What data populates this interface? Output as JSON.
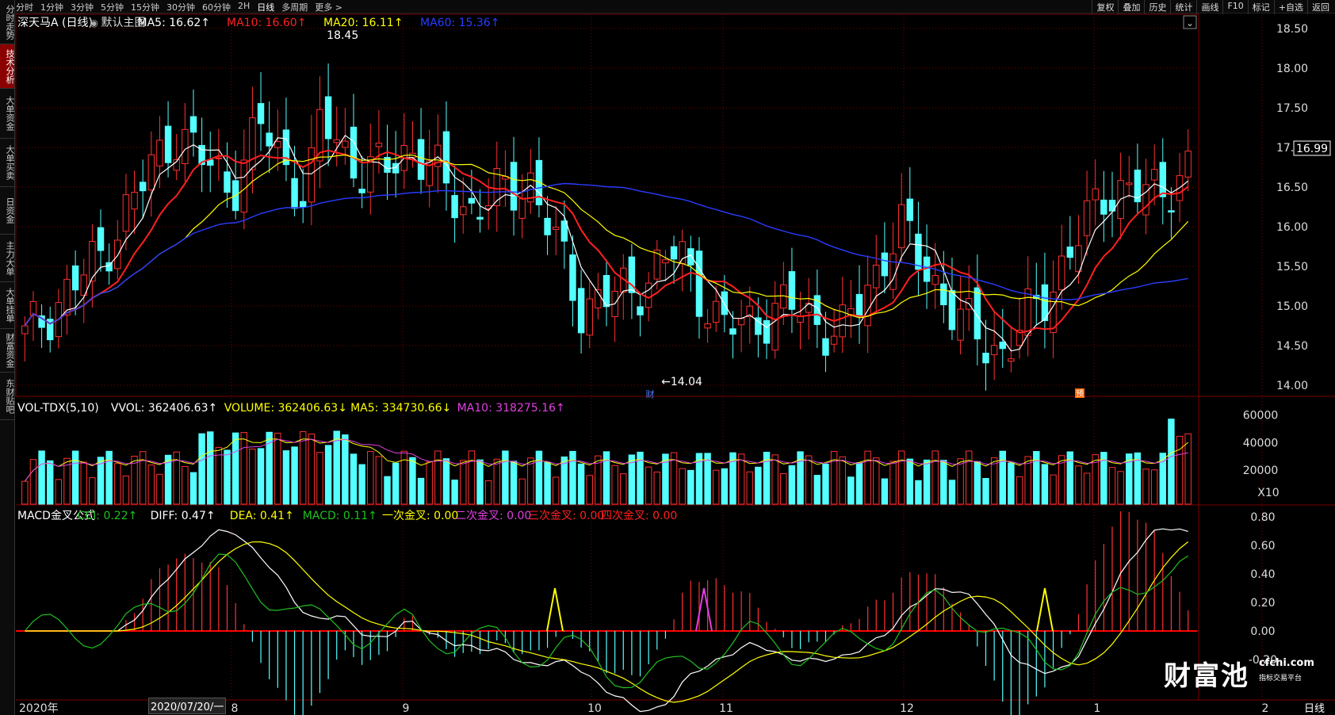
{
  "toolbar": {
    "periods": [
      "分时",
      "1分钟",
      "3分钟",
      "5分钟",
      "15分钟",
      "30分钟",
      "60分钟",
      "2H",
      "日线",
      "多周期",
      "更多 >"
    ],
    "active_period": "日线",
    "right_buttons": [
      "复权",
      "叠加",
      "历史",
      "统计",
      "画线",
      "F10",
      "标记",
      "+自选",
      "返回"
    ]
  },
  "sidebar": {
    "tabs": [
      "分时走势",
      "技术分析",
      "大单资金",
      "大单买卖",
      "日资金",
      "主力大单",
      "大单挂单",
      "财富资金",
      "东财贴吧"
    ],
    "active": "技术分析"
  },
  "main_chart": {
    "stock": "深天马A (日线)",
    "template": "默认主图",
    "ma": [
      {
        "label": "MA5: 16.62",
        "color": "#ffffff"
      },
      {
        "label": "MA10: 16.60",
        "color": "#ff2020"
      },
      {
        "label": "MA20: 16.11",
        "color": "#ffff00"
      },
      {
        "label": "MA60: 15.36",
        "color": "#2a3cff"
      }
    ],
    "high_label": "18.45",
    "low_label": "14.04",
    "price_ticks": [
      "18.50",
      "18.00",
      "17.50",
      "17.00",
      "16.50",
      "16.00",
      "15.50",
      "15.00",
      "14.50",
      "14.00"
    ],
    "current_price": "16.99",
    "markers": [
      {
        "text": "财",
        "color": "#4a7dff"
      },
      {
        "text": "预",
        "color": "#ff6600"
      }
    ]
  },
  "volume_chart": {
    "title": "VOL-TDX(5,10)",
    "vvol": "VVOL: 362406.63",
    "volume": "VOLUME: 362406.63",
    "ma5": "MA5: 334730.66",
    "ma10": "MA10: 318275.16",
    "ticks": [
      "60000",
      "40000",
      "20000"
    ],
    "unit": "X10"
  },
  "macd_chart": {
    "title": "MACD金叉公式",
    "cci": "CCI: 0.22",
    "diff": "DIFF: 0.47",
    "dea": "DEA: 0.41",
    "macd": "MACD: 0.11",
    "cross1": "一次金叉: 0.00",
    "cross2": "二次金叉: 0.00",
    "cross3": "三次金叉: 0.00",
    "cross4": "四次金叉: 0.00",
    "ticks": [
      "0.80",
      "0.60",
      "0.40",
      "0.20",
      "0.00",
      "-0.20"
    ]
  },
  "x_axis": {
    "labels": [
      "2020年",
      "8",
      "9",
      "10",
      "11",
      "12",
      "1",
      "2"
    ],
    "date_tip": "2020/07/20/一",
    "period": "日线"
  },
  "watermark": {
    "name": "财富池",
    "domain": "cfchi.com",
    "subtitle": "指标交易平台"
  },
  "colors": {
    "up": "#ff3030",
    "down": "#54ffff",
    "ma5": "#ffffff",
    "ma10": "#ff2020",
    "ma20": "#ffff00",
    "ma60": "#2a3cff",
    "grid": "#7a0000",
    "cross_hair": "#ff0000"
  }
}
